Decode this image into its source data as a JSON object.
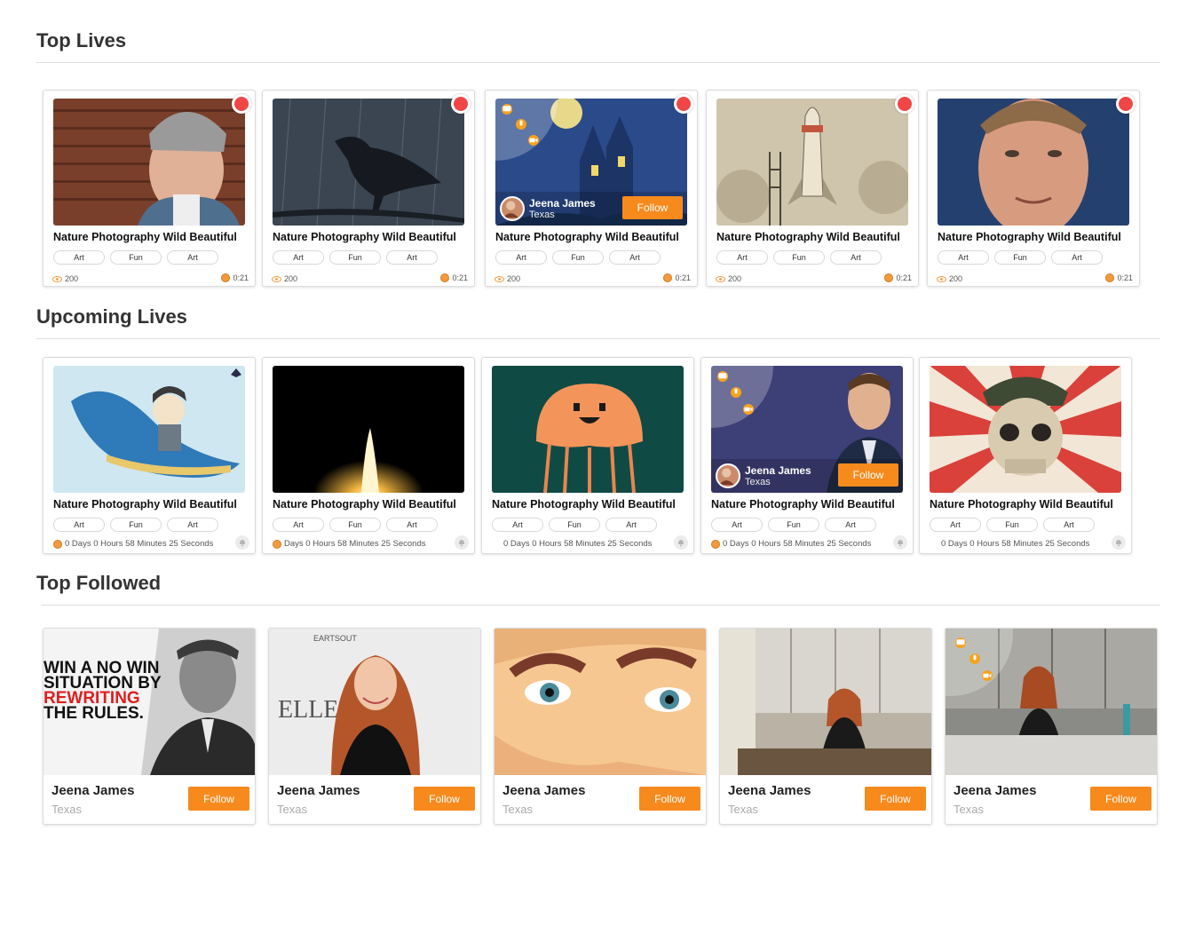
{
  "sections": {
    "top_lives": "Top Lives",
    "upcoming_lives": "Upcoming Lives",
    "top_followed": "Top Followed"
  },
  "top_lives": [
    {
      "title": "Nature Photography Wild Beautiful",
      "tags": [
        "Art",
        "Fun",
        "Art"
      ],
      "viewers": "200",
      "duration": "0:21"
    },
    {
      "title": "Nature Photography Wild Beautiful",
      "tags": [
        "Art",
        "Fun",
        "Art"
      ],
      "viewers": "200",
      "duration": "0:21"
    },
    {
      "title": "Nature Photography Wild Beautiful",
      "tags": [
        "Art",
        "Fun",
        "Art"
      ],
      "viewers": "200",
      "duration": "0:21",
      "overlay": {
        "name": "Jeena James",
        "location": "Texas",
        "follow": "Follow"
      }
    },
    {
      "title": "Nature Photography Wild Beautiful",
      "tags": [
        "Art",
        "Fun",
        "Art"
      ],
      "viewers": "200",
      "duration": "0:21"
    },
    {
      "title": "Nature Photography Wild Beautiful",
      "tags": [
        "Art",
        "Fun",
        "Art"
      ],
      "viewers": "200",
      "duration": "0:21"
    }
  ],
  "upcoming_lives": [
    {
      "title": "Nature Photography Wild Beautiful",
      "tags": [
        "Art",
        "Fun",
        "Art"
      ],
      "countdown": "0 Days 0 Hours 58 Minutes 25 Seconds"
    },
    {
      "title": "Nature Photography Wild Beautiful",
      "tags": [
        "Art",
        "Fun",
        "Art"
      ],
      "countdown": "Days 0 Hours 58 Minutes 25 Seconds"
    },
    {
      "title": "Nature Photography Wild Beautiful",
      "tags": [
        "Art",
        "Fun",
        "Art"
      ],
      "countdown": "0 Days 0 Hours 58 Minutes 25 Seconds"
    },
    {
      "title": "Nature Photography Wild Beautiful",
      "tags": [
        "Art",
        "Fun",
        "Art"
      ],
      "countdown": "0 Days 0 Hours 58 Minutes 25 Seconds",
      "overlay": {
        "name": "Jeena James",
        "location": "Texas",
        "follow": "Follow"
      }
    },
    {
      "title": "Nature Photography Wild Beautiful",
      "tags": [
        "Art",
        "Fun",
        "Art"
      ],
      "countdown": "0 Days 0 Hours 58 Minutes 25 Seconds"
    }
  ],
  "top_followed": [
    {
      "name": "Jeena James",
      "location": "Texas",
      "follow": "Follow",
      "poster_lines": [
        "WIN A NO WIN",
        "SITUATION BY",
        "REWRITING",
        "THE RULES."
      ],
      "backdrop_text": "EARTSOUT"
    },
    {
      "name": "Jeena James",
      "location": "Texas",
      "follow": "Follow",
      "backdrop_text": "ELLE"
    },
    {
      "name": "Jeena James",
      "location": "Texas",
      "follow": "Follow"
    },
    {
      "name": "Jeena James",
      "location": "Texas",
      "follow": "Follow"
    },
    {
      "name": "Jeena James",
      "location": "Texas",
      "follow": "Follow"
    }
  ],
  "colors": {
    "accent": "#f78a1d",
    "live": "#f04646",
    "coin": "#f59a3b"
  }
}
